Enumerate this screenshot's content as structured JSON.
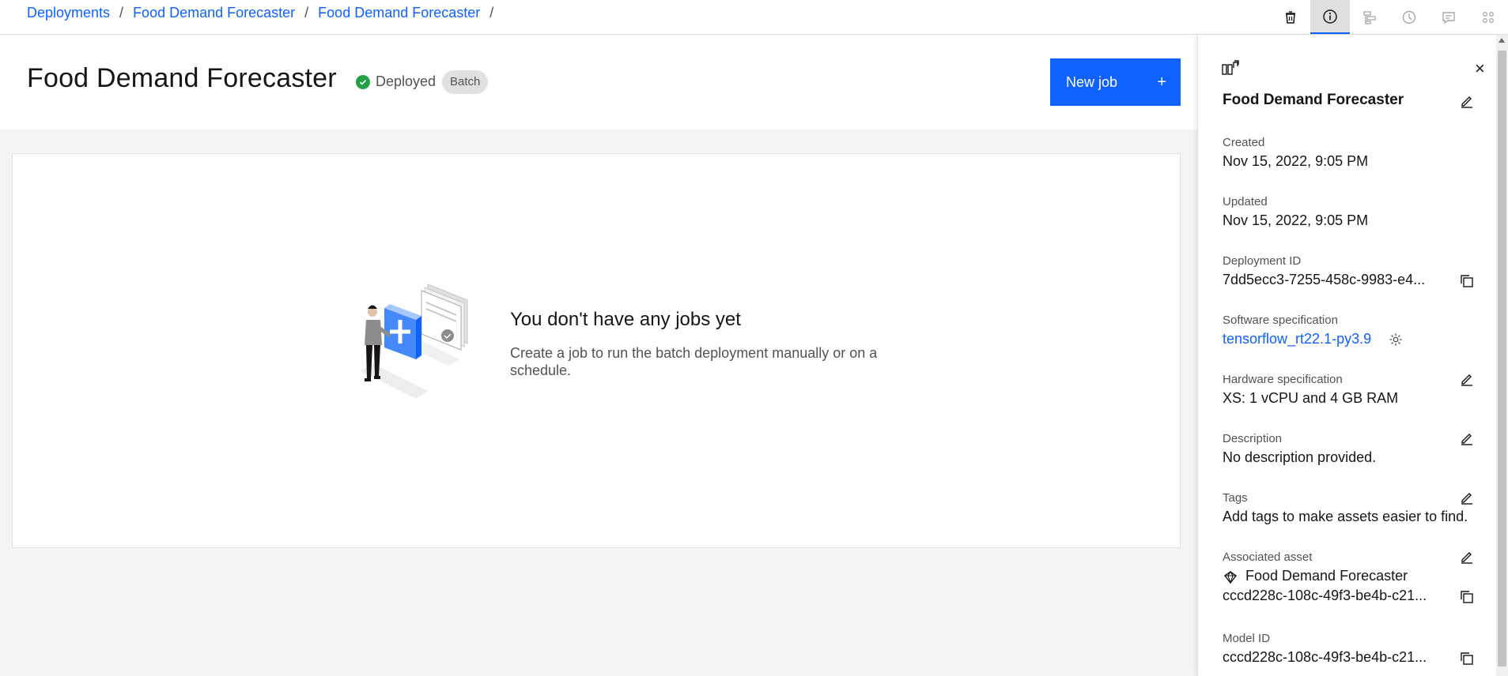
{
  "breadcrumb": {
    "items": [
      "Deployments",
      "Food Demand Forecaster",
      "Food Demand Forecaster"
    ],
    "separator": "/"
  },
  "toolbar": {
    "icons": [
      "trash-icon",
      "info-icon",
      "hierarchy-icon",
      "history-icon",
      "comment-icon",
      "apps-icon"
    ],
    "active": "info-icon"
  },
  "header": {
    "title": "Food Demand Forecaster",
    "status": "Deployed",
    "badge": "Batch",
    "new_job_label": "New job",
    "new_job_icon": "+"
  },
  "empty_state": {
    "title": "You don't have any jobs yet",
    "description": "Create a job to run the batch deployment manually or on a schedule."
  },
  "panel": {
    "title": "Food Demand Forecaster",
    "close_icon": "×",
    "created_label": "Created",
    "created_value": "Nov 15, 2022, 9:05 PM",
    "updated_label": "Updated",
    "updated_value": "Nov 15, 2022, 9:05 PM",
    "deployment_id_label": "Deployment ID",
    "deployment_id_value": "7dd5ecc3-7255-458c-9983-e4...",
    "software_spec_label": "Software specification",
    "software_spec_value": "tensorflow_rt22.1-py3.9",
    "hardware_spec_label": "Hardware specification",
    "hardware_spec_value": "XS: 1 vCPU and 4 GB RAM",
    "description_label": "Description",
    "description_value": "No description provided.",
    "tags_label": "Tags",
    "tags_value": "Add tags to make assets easier to find.",
    "associated_asset_label": "Associated asset",
    "associated_asset_name": "Food Demand Forecaster",
    "associated_asset_id": "cccd228c-108c-49f3-be4b-c21...",
    "model_id_label": "Model ID",
    "model_id_value": "cccd228c-108c-49f3-be4b-c21..."
  },
  "colors": {
    "accent": "#0f62fe",
    "success": "#24a148",
    "background": "#f4f4f4"
  }
}
